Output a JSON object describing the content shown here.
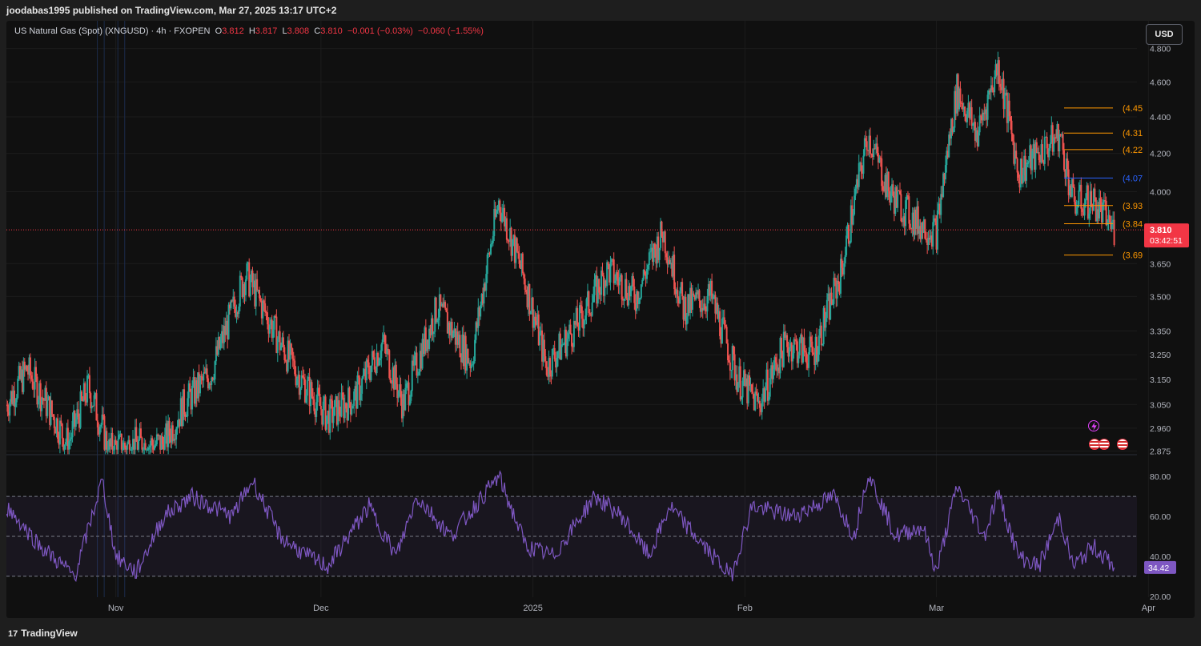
{
  "header": {
    "publisher": "joodabas1995 published on TradingView.com, Mar 27, 2025 13:17 UTC+2"
  },
  "legend": {
    "symbol": "US Natural Gas (Spot) (XNGUSD) · 4h · FXOPEN",
    "o_label": "O",
    "o": "3.812",
    "h_label": "H",
    "h": "3.817",
    "l_label": "L",
    "l": "3.808",
    "c_label": "C",
    "c": "3.810",
    "change": "−0.001 (−0.03%)",
    "change2": "−0.060 (−1.55%)"
  },
  "currency_button": "USD",
  "branding": {
    "logo": "TradingView",
    "logo_mark": "17"
  },
  "colors": {
    "up": "#26a69a",
    "down": "#ef5350",
    "rsi": "#7e57c2",
    "level_orange": "#ff9800",
    "level_blue": "#2962ff",
    "price_tag": "#f23645"
  },
  "icons": [
    "lightning-event-icon",
    "us-flag-event-icon",
    "us-flag-event-icon",
    "us-flag-event-icon"
  ],
  "chart_data": [
    {
      "type": "candlestick",
      "title": "US Natural Gas (Spot) (XNGUSD) · 4h · FXOPEN",
      "x_ticks": [
        "Nov",
        "Dec",
        "2025",
        "Feb",
        "Mar",
        "Apr"
      ],
      "y_ticks": [
        "4.800",
        "4.600",
        "4.400",
        "4.200",
        "4.000",
        "3.650",
        "3.500",
        "3.350",
        "3.250",
        "3.150",
        "3.050",
        "2.960",
        "2.875"
      ],
      "y_scale": "log",
      "ylim": [
        2.875,
        4.8
      ],
      "approx_close_path": [
        [
          "Oct 16",
          3.05
        ],
        [
          "Oct 19",
          3.19
        ],
        [
          "Oct 25",
          2.9
        ],
        [
          "Oct 28",
          3.12
        ],
        [
          "Oct 31",
          2.88
        ],
        [
          "Nov 4",
          2.9
        ],
        [
          "Nov 8",
          2.9
        ],
        [
          "Nov 11",
          3.05
        ],
        [
          "Nov 15",
          3.18
        ],
        [
          "Nov 20",
          3.6
        ],
        [
          "Nov 25",
          3.3
        ],
        [
          "Nov 28",
          3.15
        ],
        [
          "Dec 2",
          3.0
        ],
        [
          "Dec 6",
          3.08
        ],
        [
          "Dec 10",
          3.3
        ],
        [
          "Dec 13",
          3.05
        ],
        [
          "Dec 18",
          3.45
        ],
        [
          "Dec 23",
          3.22
        ],
        [
          "Dec 27",
          3.95
        ],
        [
          "Dec 31",
          3.55
        ],
        [
          "Jan 3",
          3.2
        ],
        [
          "Jan 8",
          3.4
        ],
        [
          "Jan 12",
          3.62
        ],
        [
          "Jan 16",
          3.5
        ],
        [
          "Jan 20",
          3.8
        ],
        [
          "Jan 23",
          3.45
        ],
        [
          "Jan 27",
          3.5
        ],
        [
          "Jan 31",
          3.15
        ],
        [
          "Feb 3",
          3.05
        ],
        [
          "Feb 7",
          3.3
        ],
        [
          "Feb 11",
          3.25
        ],
        [
          "Feb 15",
          3.6
        ],
        [
          "Feb 19",
          4.3
        ],
        [
          "Feb 22",
          4.0
        ],
        [
          "Feb 26",
          3.85
        ],
        [
          "Mar 1",
          3.8
        ],
        [
          "Mar 4",
          4.55
        ],
        [
          "Mar 7",
          4.3
        ],
        [
          "Mar 10",
          4.7
        ],
        [
          "Mar 13",
          4.1
        ],
        [
          "Mar 16",
          4.2
        ],
        [
          "Mar 19",
          4.3
        ],
        [
          "Mar 21",
          3.95
        ],
        [
          "Mar 24",
          3.95
        ],
        [
          "Mar 27",
          3.81
        ]
      ],
      "last_price": "3.810",
      "countdown": "03:42:51",
      "levels": [
        {
          "label": "(4.45",
          "value": 4.45,
          "color": "orange"
        },
        {
          "label": "(4.31",
          "value": 4.31,
          "color": "orange"
        },
        {
          "label": "(4.22",
          "value": 4.22,
          "color": "orange"
        },
        {
          "label": "(4.07",
          "value": 4.07,
          "color": "blue"
        },
        {
          "label": "(3.93",
          "value": 3.93,
          "color": "orange"
        },
        {
          "label": "(3.84",
          "value": 3.84,
          "color": "orange"
        },
        {
          "label": "(3.69",
          "value": 3.69,
          "color": "orange"
        }
      ]
    },
    {
      "type": "line",
      "y_ticks": [
        "80.00",
        "60.00",
        "40.00",
        "20.00"
      ],
      "ylim": [
        20,
        80
      ],
      "bands": [
        30,
        50,
        70
      ],
      "last_value": "34.42",
      "approx_values": [
        [
          "Oct 16",
          65
        ],
        [
          "Oct 21",
          45
        ],
        [
          "Oct 26",
          30
        ],
        [
          "Oct 30",
          78
        ],
        [
          "Nov 1",
          40
        ],
        [
          "Nov 4",
          32
        ],
        [
          "Nov 8",
          60
        ],
        [
          "Nov 12",
          70
        ],
        [
          "Nov 18",
          60
        ],
        [
          "Nov 21",
          78
        ],
        [
          "Nov 25",
          50
        ],
        [
          "Nov 29",
          40
        ],
        [
          "Dec 2",
          35
        ],
        [
          "Dec 8",
          65
        ],
        [
          "Dec 12",
          40
        ],
        [
          "Dec 15",
          70
        ],
        [
          "Dec 20",
          50
        ],
        [
          "Dec 27",
          80
        ],
        [
          "Dec 31",
          45
        ],
        [
          "Jan 4",
          40
        ],
        [
          "Jan 10",
          70
        ],
        [
          "Jan 14",
          60
        ],
        [
          "Jan 18",
          40
        ],
        [
          "Jan 21",
          65
        ],
        [
          "Jan 26",
          45
        ],
        [
          "Jan 30",
          30
        ],
        [
          "Feb 2",
          65
        ],
        [
          "Feb 8",
          60
        ],
        [
          "Feb 14",
          70
        ],
        [
          "Feb 17",
          50
        ],
        [
          "Feb 19",
          82
        ],
        [
          "Feb 23",
          50
        ],
        [
          "Feb 27",
          55
        ],
        [
          "Mar 1",
          32
        ],
        [
          "Mar 4",
          75
        ],
        [
          "Mar 8",
          50
        ],
        [
          "Mar 10",
          72
        ],
        [
          "Mar 13",
          40
        ],
        [
          "Mar 16",
          35
        ],
        [
          "Mar 19",
          60
        ],
        [
          "Mar 21",
          35
        ],
        [
          "Mar 24",
          45
        ],
        [
          "Mar 27",
          34.42
        ]
      ]
    }
  ]
}
